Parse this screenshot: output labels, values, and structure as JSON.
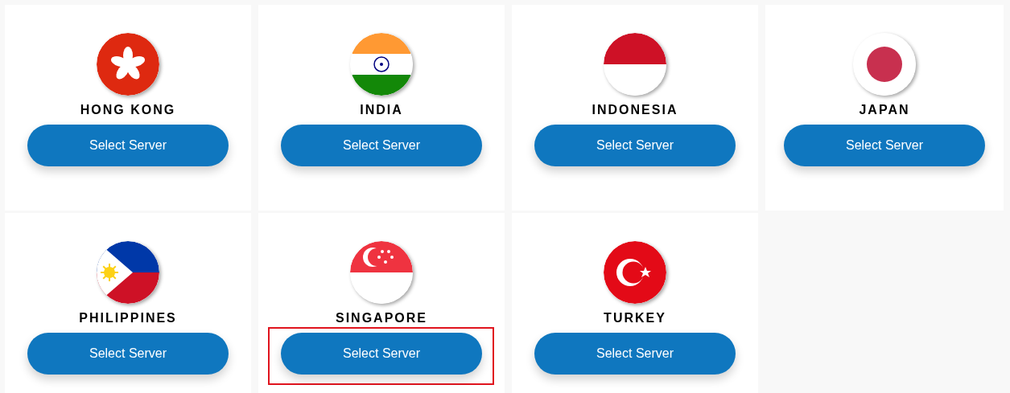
{
  "servers": [
    {
      "country": "HONG KONG",
      "button": "Select Server",
      "highlighted": false
    },
    {
      "country": "INDIA",
      "button": "Select Server",
      "highlighted": false
    },
    {
      "country": "INDONESIA",
      "button": "Select Server",
      "highlighted": false
    },
    {
      "country": "JAPAN",
      "button": "Select Server",
      "highlighted": false
    },
    {
      "country": "PHILIPPINES",
      "button": "Select Server",
      "highlighted": false
    },
    {
      "country": "SINGAPORE",
      "button": "Select Server",
      "highlighted": true
    },
    {
      "country": "TURKEY",
      "button": "Select Server",
      "highlighted": false
    }
  ]
}
